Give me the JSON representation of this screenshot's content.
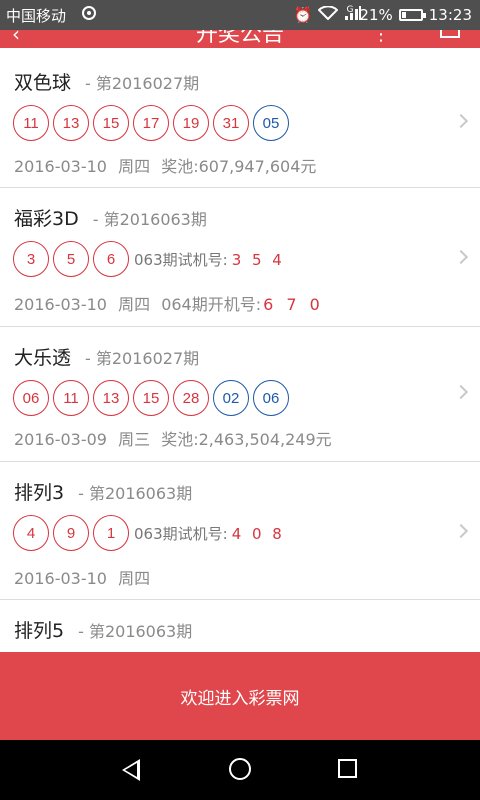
{
  "status_bar": {
    "carrier": "中国移动",
    "network": "G",
    "battery_text": "21%",
    "battery_level": 0.21,
    "time": "13:23"
  },
  "header": {
    "title": "开奖公告"
  },
  "lotteries": [
    {
      "name": "双色球",
      "issue": "- 第2016027期",
      "red_balls": [
        "11",
        "13",
        "15",
        "17",
        "19",
        "31"
      ],
      "blue_balls": [
        "05"
      ],
      "date": "2016-03-10",
      "weekday": "周四",
      "extra_label": "奖池:",
      "extra_value": "607,947,604元"
    },
    {
      "name": "福彩3D",
      "issue": "- 第2016063期",
      "red_balls": [
        "3",
        "5",
        "6"
      ],
      "trial_label": "063期试机号:",
      "trial_value": "3 5 4",
      "date": "2016-03-10",
      "weekday": "周四",
      "extra_label": "064期开机号:",
      "extra_value": "6 7 0"
    },
    {
      "name": "大乐透",
      "issue": "- 第2016027期",
      "red_balls": [
        "06",
        "11",
        "13",
        "15",
        "28"
      ],
      "blue_balls": [
        "02",
        "06"
      ],
      "date": "2016-03-09",
      "weekday": "周三",
      "extra_label": "奖池:",
      "extra_value": "2,463,504,249元"
    },
    {
      "name": "排列3",
      "issue": "- 第2016063期",
      "red_balls": [
        "4",
        "9",
        "1"
      ],
      "trial_label": "063期试机号:",
      "trial_value": "4 0 8",
      "date": "2016-03-10",
      "weekday": "周四"
    },
    {
      "name": "排列5",
      "issue": "- 第2016063期"
    }
  ],
  "footer": {
    "enter_label": "欢迎进入彩票网"
  },
  "colors": {
    "accent": "#e0474c",
    "red_ball": "#d7353f",
    "blue_ball": "#1e5aa8"
  }
}
